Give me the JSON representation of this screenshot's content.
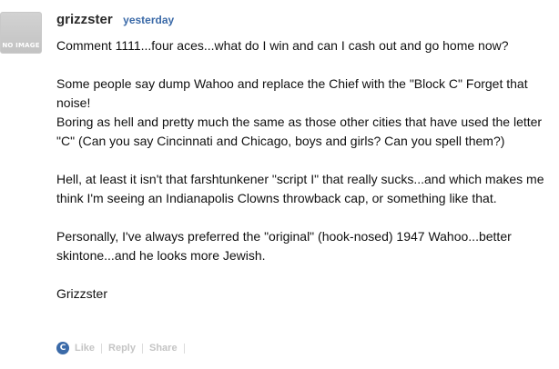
{
  "comment": {
    "avatar_text": "NO IMAGE",
    "username": "grizzster",
    "timestamp": "yesterday",
    "paragraphs": [
      "Comment 1111...four aces...what do I win and can I cash out and go home now?",
      "Some people say dump Wahoo and replace the Chief with the \"Block C\" Forget that noise!",
      "Boring as hell and pretty much the same as those other cities that have used the letter \"C\" (Can you say Cincinnati and Chicago, boys and girls? Can you spell them?)",
      "Hell, at least it isn't that farshtunkener \"script I\" that really sucks...and which makes me think I'm seeing an Indianapolis Clowns throwback cap, or something like that.",
      "Personally, I've always preferred the \"original\" (hook-nosed) 1947 Wahoo...better skintone...and he looks more Jewish.",
      "Grizzster"
    ]
  },
  "actions": {
    "like_label": "Like",
    "reply_label": "Reply",
    "share_label": "Share",
    "like_icon": "C"
  },
  "colors": {
    "username": "#2a2a2a",
    "timestamp": "#3b6aa8",
    "like_icon_bg": "#3b6aa8",
    "action_text": "#c4c4c4"
  }
}
